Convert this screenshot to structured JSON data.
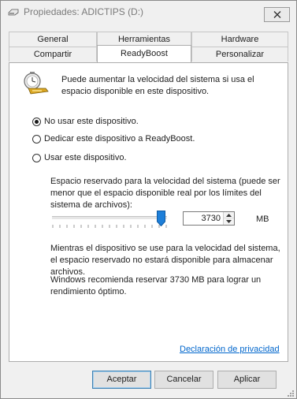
{
  "window": {
    "title": "Propiedades: ADICTIPS (D:)"
  },
  "tabs": {
    "row_back": [
      {
        "label": "General"
      },
      {
        "label": "Herramientas"
      },
      {
        "label": "Hardware"
      }
    ],
    "row_front": [
      {
        "label": "Compartir"
      },
      {
        "label": "ReadyBoost",
        "active": true
      },
      {
        "label": "Personalizar"
      }
    ]
  },
  "readyboost": {
    "intro": "Puede aumentar la velocidad del sistema si usa el espacio disponible en este dispositivo.",
    "options": [
      {
        "label": "No usar este dispositivo.",
        "checked": true
      },
      {
        "label": "Dedicar este dispositivo a ReadyBoost.",
        "checked": false
      },
      {
        "label": "Usar este dispositivo.",
        "checked": false
      }
    ],
    "space_label": "Espacio reservado para la velocidad del sistema (puede ser menor que el espacio disponible real por los límites del sistema de archivos):",
    "slider_level": 1.0,
    "space_value": "3730",
    "unit": "MB",
    "note": "Mientras el dispositivo se use para la velocidad del sistema, el espacio reservado no estará disponible para almacenar archivos.",
    "recommendation": "Windows recomienda reservar 3730 MB para lograr un rendimiento óptimo.",
    "privacy_link": "Declaración de privacidad"
  },
  "buttons": {
    "accept": "Aceptar",
    "cancel": "Cancelar",
    "apply": "Aplicar"
  },
  "colors": {
    "link": "#0066cc",
    "slider_thumb": "#1e7fd9"
  }
}
